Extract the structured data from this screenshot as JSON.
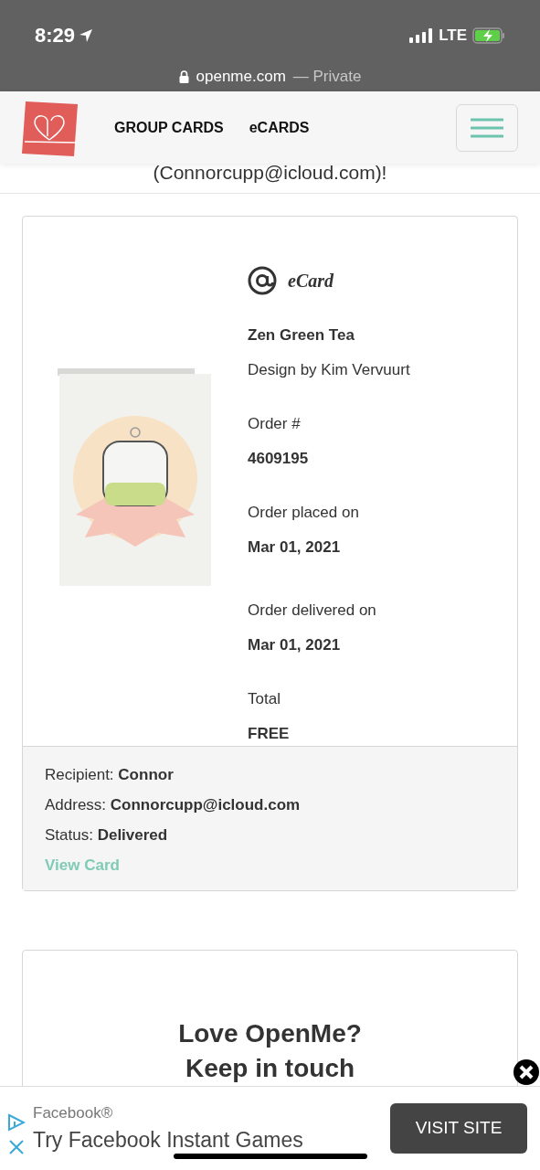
{
  "status_bar": {
    "time": "8:29",
    "network": "LTE"
  },
  "browser": {
    "url": "openme.com",
    "mode": "— Private"
  },
  "nav": {
    "items": [
      "GROUP CARDS",
      "eCARDS"
    ]
  },
  "intro_text": "(Connorcupp@icloud.com)!",
  "order": {
    "card_type": "eCard",
    "title": "Zen Green Tea",
    "designer": "Design by Kim Vervuurt",
    "fields": [
      {
        "label": "Order #",
        "value": "4609195"
      },
      {
        "label": "Order placed on",
        "value": "Mar 01, 2021"
      },
      {
        "label": "Order delivered on",
        "value": "Mar 01, 2021"
      },
      {
        "label": "Total",
        "value": "FREE"
      }
    ],
    "details": [
      {
        "label": "Recipient:",
        "value": "Connor"
      },
      {
        "label": "Address:",
        "value": "Connorcupp@icloud.com"
      },
      {
        "label": "Status:",
        "value": "Delivered"
      }
    ],
    "link": "View Card"
  },
  "newsletter": {
    "title_lines": [
      "Love OpenMe?",
      "Keep in touch"
    ]
  },
  "ad": {
    "brand": "Facebook®",
    "headline": "Try Facebook Instant Games",
    "button": "VISIT SITE"
  }
}
